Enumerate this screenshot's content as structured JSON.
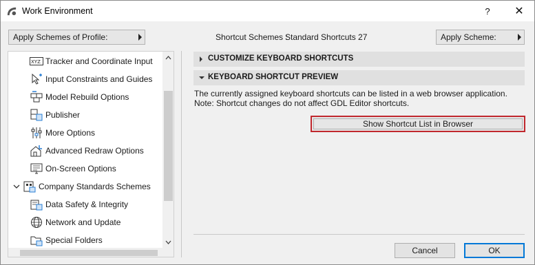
{
  "window": {
    "title": "Work Environment",
    "help_label": "?",
    "close_label": "✕"
  },
  "toolbar": {
    "profile_button": "Apply Schemes of Profile:",
    "shortcut_schemes_label": "Shortcut Schemes :",
    "shortcut_schemes_value": "Standard Shortcuts 27",
    "apply_button": "Apply Scheme:"
  },
  "tree": {
    "items": [
      {
        "label": "Tracker and Coordinate Input",
        "icon": "xyz-tracker-icon"
      },
      {
        "label": "Input Constraints and Guides",
        "icon": "cursor-guides-icon"
      },
      {
        "label": "Model Rebuild Options",
        "icon": "model-rebuild-icon"
      },
      {
        "label": "Publisher",
        "icon": "publisher-icon"
      },
      {
        "label": "More Options",
        "icon": "sliders-icon"
      },
      {
        "label": "Advanced Redraw Options",
        "icon": "house-redraw-icon"
      },
      {
        "label": "On-Screen Options",
        "icon": "monitor-icon"
      },
      {
        "label": "Company Standards Schemes",
        "icon": "company-standards-icon",
        "expanded": true
      },
      {
        "label": "Data Safety & Integrity",
        "icon": "data-safety-icon"
      },
      {
        "label": "Network and Update",
        "icon": "globe-icon"
      },
      {
        "label": "Special Folders",
        "icon": "folder-icon"
      }
    ]
  },
  "right": {
    "customize_header": "CUSTOMIZE KEYBOARD SHORTCUTS",
    "preview_header": "KEYBOARD SHORTCUT PREVIEW",
    "desc_line1": "The currently assigned keyboard shortcuts can be listed in a web browser application.",
    "desc_line2": "Note: Shortcut changes do not affect GDL Editor shortcuts.",
    "show_button": "Show Shortcut List in Browser"
  },
  "footer": {
    "cancel": "Cancel",
    "ok": "OK"
  },
  "colors": {
    "highlight_border": "#c0272d",
    "default_button_border": "#0078d7",
    "section_header_bg": "#e0e0e0"
  }
}
